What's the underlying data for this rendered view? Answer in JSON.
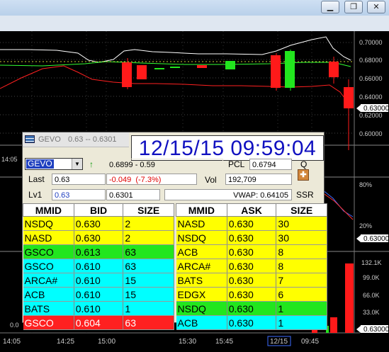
{
  "window": {
    "minimize_glyph": "▁",
    "restore_glyph": "❐",
    "close_glyph": "✕"
  },
  "chart": {
    "price_axis": [
      "0.70000",
      "0.68000",
      "0.66000",
      "0.64000",
      "0.62000",
      "0.60000"
    ],
    "volume_axis": [
      "132.1K",
      "99.0K",
      "66.0K",
      "33.0K"
    ],
    "indicator_axis": [
      "80%",
      "20%"
    ],
    "time_labels": [
      "14:05",
      "14:25",
      "15:00",
      "15:30",
      "15:45",
      "12/15",
      "09:45"
    ],
    "price_tags": [
      "0.63000",
      "0.63000",
      "0.63000"
    ],
    "left_stub_labels": [
      "14:05",
      "0.0"
    ],
    "colors": {
      "up": "#22e61e",
      "down": "#ff1a1a",
      "upper_band": "#ffffff",
      "lower_band": "#ff2020",
      "ma": "#33ff33"
    }
  },
  "level2": {
    "symbol_title": "GEVO",
    "title_range": "0.63 -- 0.6301",
    "timestamp": "12/15/15 09:59:04",
    "symbol": "GEVO",
    "arrow_glyph": "↑",
    "day_range": "0.6899 - 0.59",
    "pcl_label": "PCL",
    "pcl": "0.6794",
    "q_label": "Q",
    "last_label": "Last",
    "last": "0.63",
    "change": "-0.049",
    "change_pct": "(-7.3%)",
    "vol_label": "Vol",
    "volume": "192,709",
    "lv1_label": "Lv1",
    "lv1_bid": "0.63",
    "lv1_ask": "0.6301",
    "vwap": "VWAP: 0.64105",
    "ssr": "SSR",
    "bid_headers": [
      "MMID",
      "BID",
      "SIZE"
    ],
    "ask_headers": [
      "MMID",
      "ASK",
      "SIZE"
    ],
    "bids": [
      {
        "mmid": "NSDQ",
        "price": "0.630",
        "size": "2",
        "color": "yellow"
      },
      {
        "mmid": "NASD",
        "price": "0.630",
        "size": "2",
        "color": "yellow"
      },
      {
        "mmid": "GSCO",
        "price": "0.613",
        "size": "63",
        "color": "green"
      },
      {
        "mmid": "GSCO",
        "price": "0.610",
        "size": "63",
        "color": "cyan"
      },
      {
        "mmid": "ARCA#",
        "price": "0.610",
        "size": "15",
        "color": "cyan"
      },
      {
        "mmid": "ACB",
        "price": "0.610",
        "size": "15",
        "color": "cyan"
      },
      {
        "mmid": "BATS",
        "price": "0.610",
        "size": "1",
        "color": "cyan"
      },
      {
        "mmid": "GSCO",
        "price": "0.604",
        "size": "63",
        "color": "red"
      }
    ],
    "asks": [
      {
        "mmid": "NASD",
        "price": "0.630",
        "size": "30",
        "color": "yellow"
      },
      {
        "mmid": "NSDQ",
        "price": "0.630",
        "size": "30",
        "color": "yellow"
      },
      {
        "mmid": "ACB",
        "price": "0.630",
        "size": "8",
        "color": "yellow"
      },
      {
        "mmid": "ARCA#",
        "price": "0.630",
        "size": "8",
        "color": "yellow"
      },
      {
        "mmid": "BATS",
        "price": "0.630",
        "size": "7",
        "color": "yellow"
      },
      {
        "mmid": "EDGX",
        "price": "0.630",
        "size": "6",
        "color": "yellow"
      },
      {
        "mmid": "NSDQ",
        "price": "0.630",
        "size": "1",
        "color": "green"
      },
      {
        "mmid": "ACB",
        "price": "0.630",
        "size": "1",
        "color": "cyan"
      }
    ]
  }
}
